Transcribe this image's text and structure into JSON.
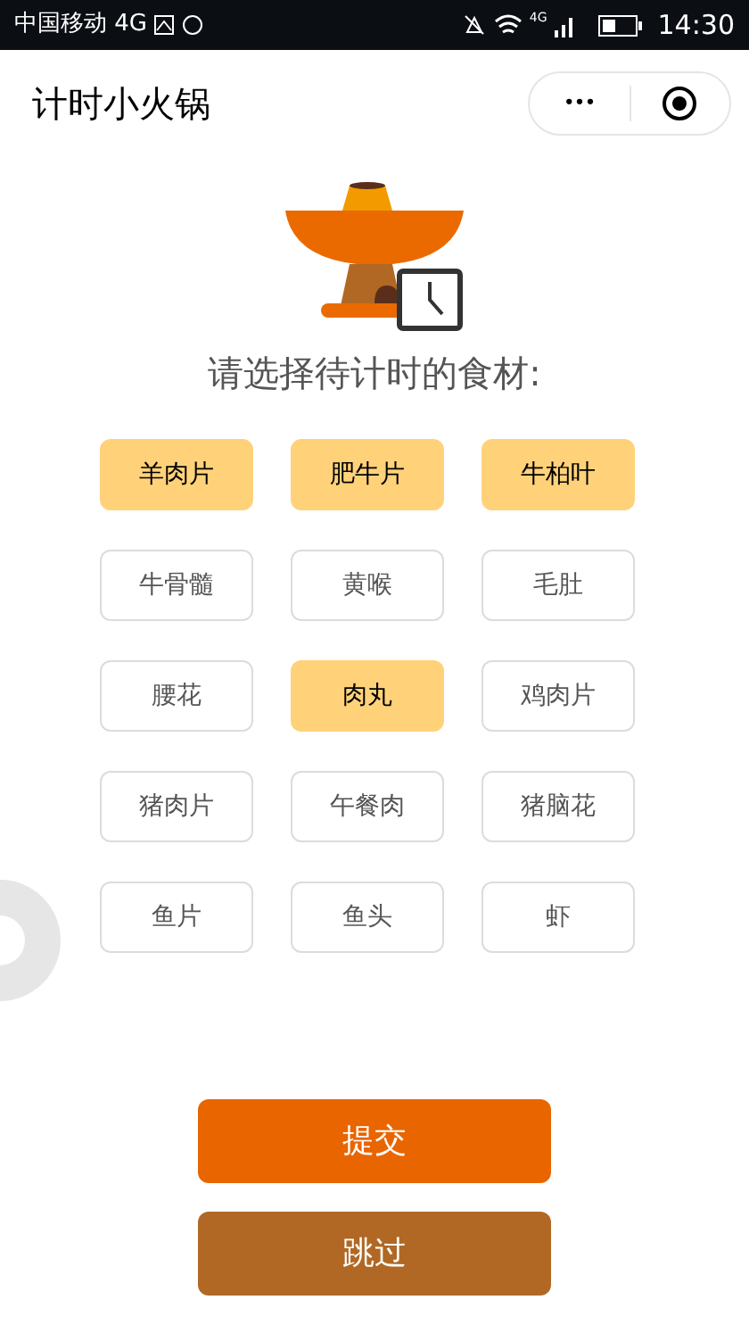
{
  "status_bar": {
    "carrier": "中国移动 4G",
    "network_badge": "4G",
    "time": "14:30"
  },
  "nav_bar": {
    "title": "计时小火锅",
    "menu_glyph": "•••"
  },
  "prompt": "请选择待计时的食材:",
  "options": [
    {
      "label": "羊肉片",
      "selected": true
    },
    {
      "label": "肥牛片",
      "selected": true
    },
    {
      "label": "牛柏叶",
      "selected": true
    },
    {
      "label": "牛骨髓",
      "selected": false
    },
    {
      "label": "黄喉",
      "selected": false
    },
    {
      "label": "毛肚",
      "selected": false
    },
    {
      "label": "腰花",
      "selected": false
    },
    {
      "label": "肉丸",
      "selected": true
    },
    {
      "label": "鸡肉片",
      "selected": false
    },
    {
      "label": "猪肉片",
      "selected": false
    },
    {
      "label": "午餐肉",
      "selected": false
    },
    {
      "label": "猪脑花",
      "selected": false
    },
    {
      "label": "鱼片",
      "selected": false
    },
    {
      "label": "鱼头",
      "selected": false
    },
    {
      "label": "虾",
      "selected": false
    }
  ],
  "buttons": [
    {
      "label": "提交",
      "kind": "primary"
    },
    {
      "label": "跳过",
      "kind": "secondary"
    }
  ]
}
